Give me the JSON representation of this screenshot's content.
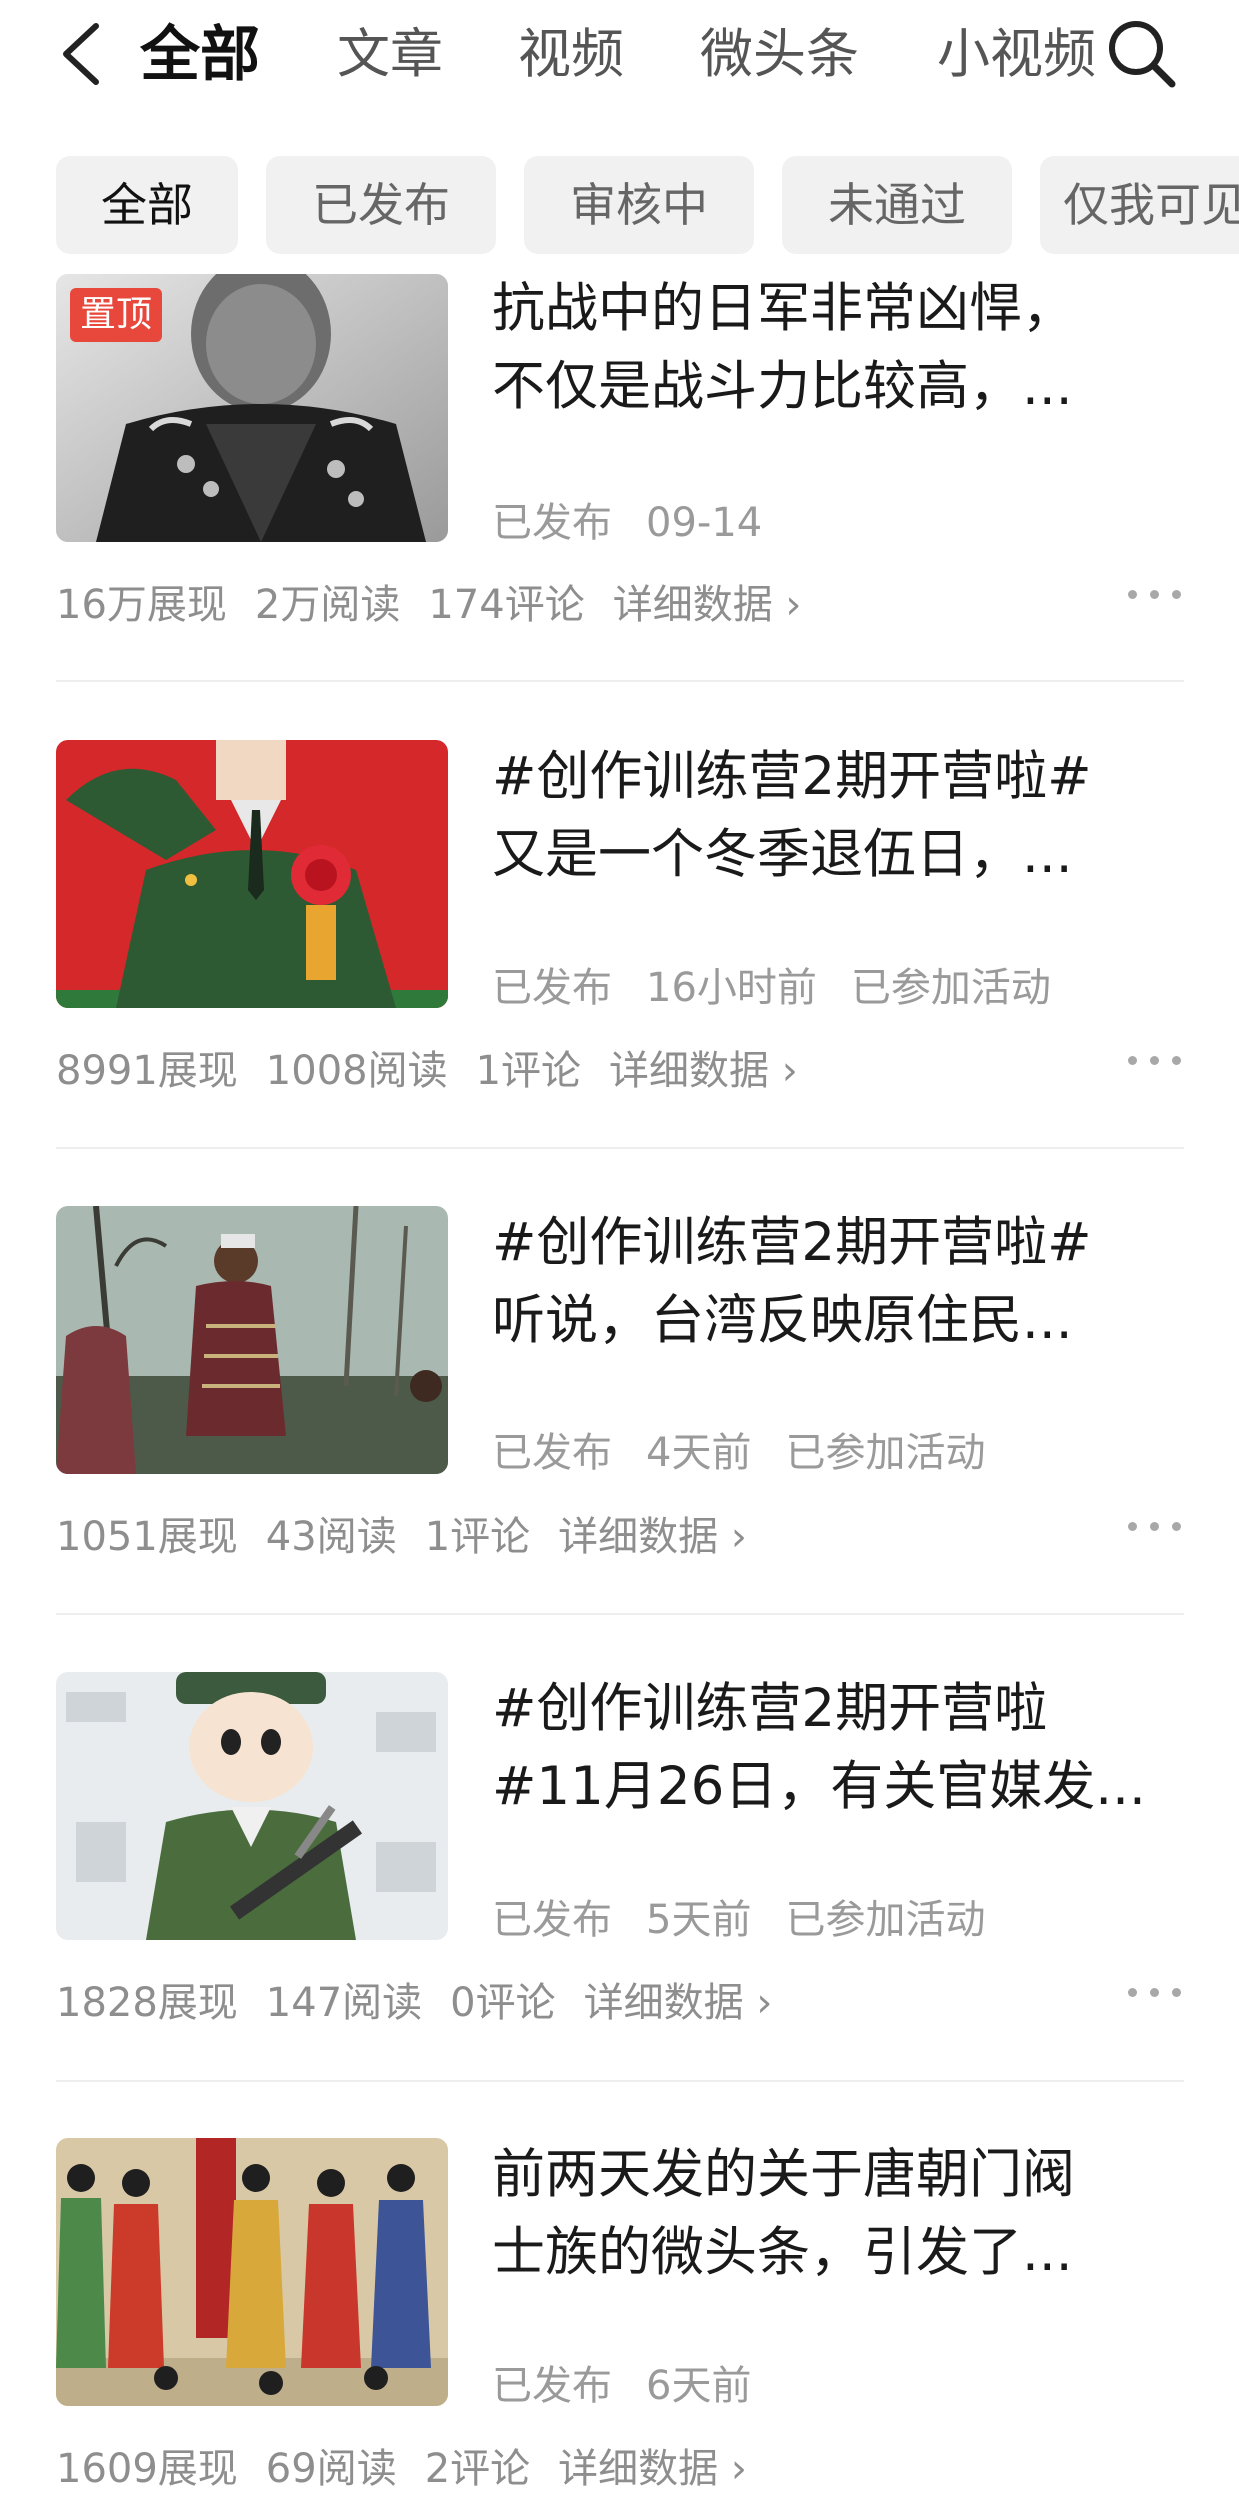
{
  "nav": {
    "tabs": [
      "全部",
      "文章",
      "视频",
      "微头条",
      "小视频"
    ]
  },
  "filters": [
    "全部",
    "已发布",
    "审核中",
    "未通过",
    "仅我可见"
  ],
  "pin_label": "置顶",
  "items": [
    {
      "title_line1": "抗战中的日军非常凶悍，",
      "title_line2": "不仅是战斗力比较高，...",
      "status": "已发布",
      "time": "09-14",
      "activity": "",
      "impressions": "16万展现",
      "reads": "2万阅读",
      "comments": "174评论",
      "detail": "详细数据 ›",
      "image": "portrait-officer"
    },
    {
      "title_line1": "#创作训练营2期开营啦#",
      "title_line2": "又是一个冬季退伍日，...",
      "status": "已发布",
      "time": "16小时前",
      "activity": "已参加活动",
      "impressions": "8991展现",
      "reads": "1008阅读",
      "comments": "1评论",
      "detail": "详细数据 ›",
      "image": "soldier-salute"
    },
    {
      "title_line1": "#创作训练营2期开营啦#",
      "title_line2": "听说，台湾反映原住民...",
      "status": "已发布",
      "time": "4天前",
      "activity": "已参加活动",
      "impressions": "1051展现",
      "reads": "43阅读",
      "comments": "1评论",
      "detail": "详细数据 ›",
      "image": "forest-villagers"
    },
    {
      "title_line1": "#创作训练营2期开营啦",
      "title_line2": "#11月26日，有关官媒发...",
      "status": "已发布",
      "time": "5天前",
      "activity": "已参加活动",
      "impressions": "1828展现",
      "reads": "147阅读",
      "comments": "0评论",
      "detail": "详细数据 ›",
      "image": "cartoon-soldier"
    },
    {
      "title_line1": "前两天发的关于唐朝门阀",
      "title_line2": "士族的微头条，引发了...",
      "status": "已发布",
      "time": "6天前",
      "activity": "",
      "impressions": "1609展现",
      "reads": "69阅读",
      "comments": "2评论",
      "detail": "详细数据 ›",
      "image": "tang-officials"
    }
  ]
}
